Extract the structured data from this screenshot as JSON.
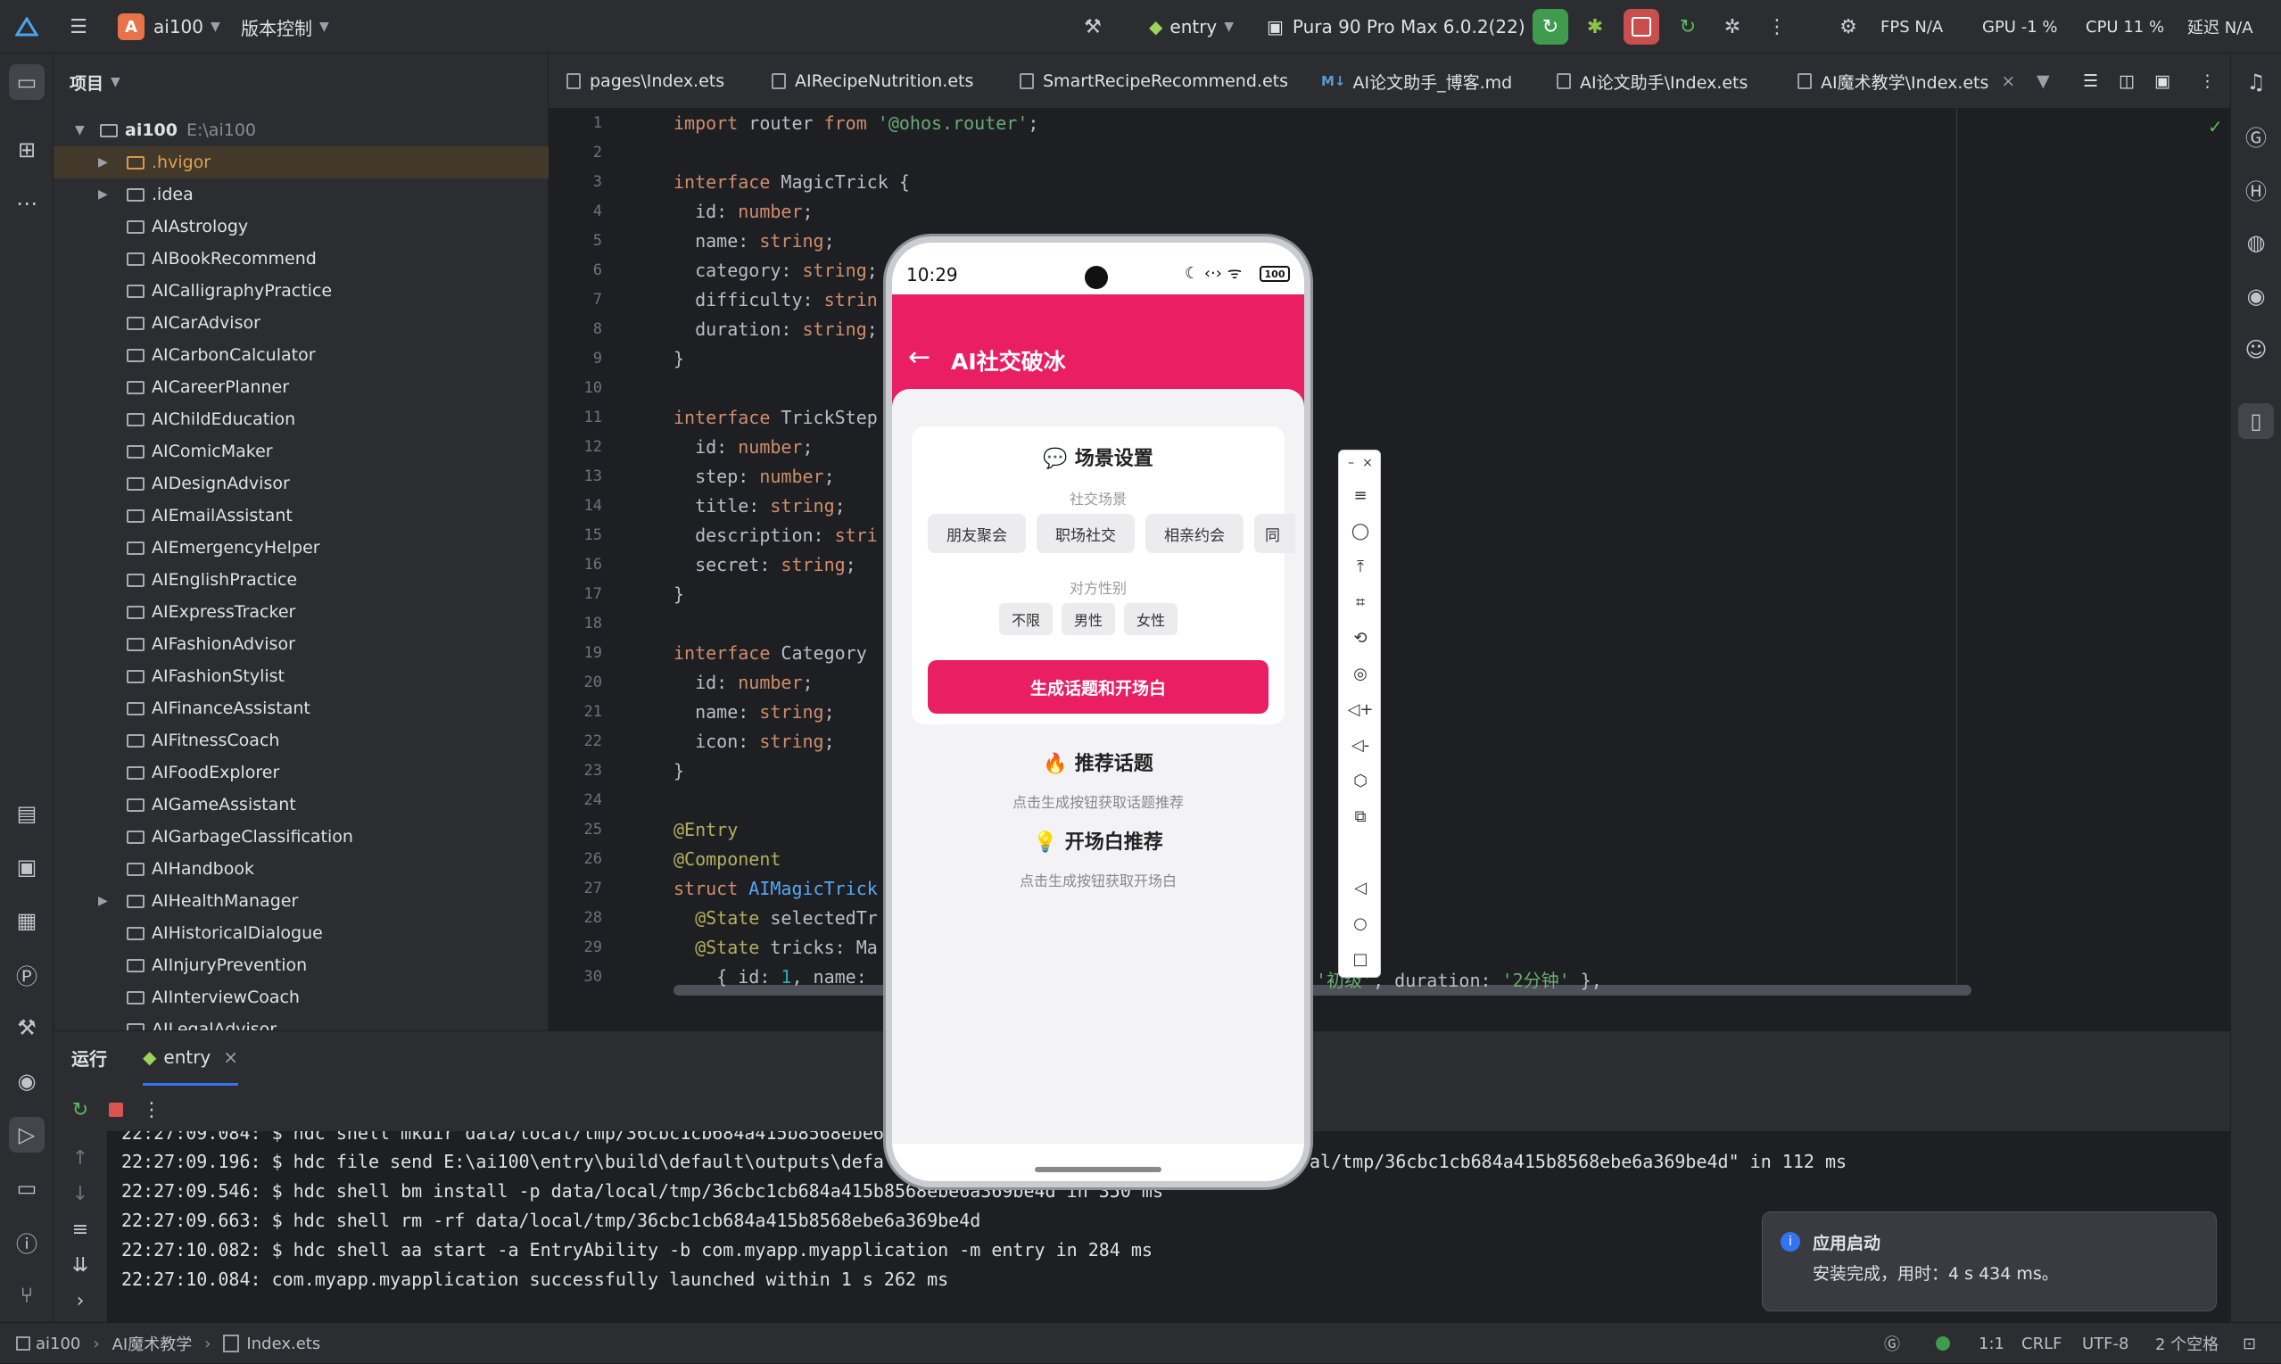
{
  "titlebar": {
    "project_badge": "A",
    "project_name": "ai100",
    "vcs_label": "版本控制",
    "run_config": "entry",
    "device": "Pura 90 Pro Max 6.0.2(22)",
    "fps": "FPS N/A",
    "gpu": "GPU -1 %",
    "cpu": "CPU 11 %",
    "latency": "延迟 N/A"
  },
  "project_panel": {
    "title": "项目",
    "root_name": "ai100",
    "root_path": "E:\\ai100",
    "items": [
      ".hvigor",
      ".idea",
      "AIAstrology",
      "AIBookRecommend",
      "AICalligraphyPractice",
      "AICarAdvisor",
      "AICarbonCalculator",
      "AICareerPlanner",
      "AIChildEducation",
      "AIComicMaker",
      "AIDesignAdvisor",
      "AIEmailAssistant",
      "AIEmergencyHelper",
      "AIEnglishPractice",
      "AIExpressTracker",
      "AIFashionAdvisor",
      "AIFashionStylist",
      "AIFinanceAssistant",
      "AIFitnessCoach",
      "AIFoodExplorer",
      "AIGameAssistant",
      "AIGarbageClassification",
      "AIHandbook",
      "AIHealthManager",
      "AIHistoricalDialogue",
      "AIInjuryPrevention",
      "AIInterviewCoach",
      "AILegalAdvisor"
    ]
  },
  "tabs": [
    "pages\\Index.ets",
    "AIRecipeNutrition.ets",
    "SmartRecipeRecommend.ets",
    "AI论文助手_博客.md",
    "AI论文助手\\Index.ets",
    "AI魔术教学\\Index.ets"
  ],
  "code": {
    "line_numbers": [
      "1",
      "2",
      "3",
      "4",
      "5",
      "6",
      "7",
      "8",
      "9",
      "10",
      "11",
      "12",
      "13",
      "14",
      "15",
      "16",
      "17",
      "18",
      "19",
      "20",
      "21",
      "22",
      "23",
      "24",
      "25",
      "26",
      "27",
      "28",
      "29",
      "30"
    ],
    "l1_kw": "import",
    "l1_mid": " router ",
    "l1_kw2": "from",
    "l1_str": "'@ohos.router'",
    "l1_end": ";",
    "l3_kw": "interface",
    "l3_name": " MagicTrick {",
    "l4a": "  id: ",
    "l4b": "number",
    "l4c": ";",
    "l5a": "  name: ",
    "l5b": "string",
    "l5c": ";",
    "l6a": "  category: ",
    "l6b": "string",
    "l6c": ";",
    "l7a": "  difficulty: ",
    "l7b": "strin",
    "l8a": "  duration: ",
    "l8b": "string",
    "l8c": ";",
    "l9": "}",
    "l11_kw": "interface",
    "l11_name": " TrickStep",
    "l12a": "  id: ",
    "l12b": "number",
    "l12c": ";",
    "l13a": "  step: ",
    "l13b": "number",
    "l13c": ";",
    "l14a": "  title: ",
    "l14b": "string",
    "l14c": ";",
    "l15a": "  description: ",
    "l15b": "stri",
    "l16a": "  secret: ",
    "l16b": "string",
    "l16c": ";",
    "l17": "}",
    "l19_kw": "interface",
    "l19_name": " Category",
    "l20a": "  id: ",
    "l20b": "number",
    "l20c": ";",
    "l21a": "  name: ",
    "l21b": "string",
    "l21c": ";",
    "l22a": "  icon: ",
    "l22b": "string",
    "l22c": ";",
    "l23": "}",
    "l25": "@Entry",
    "l26": "@Component",
    "l27_kw": "struct",
    "l27_name": " AIMagicTrick",
    "l28_dec": "  @State",
    "l28_rest": " selectedTr",
    "l29_dec": "  @State",
    "l29_rest": " tricks: Ma",
    "l30a": "    { id: ",
    "l30b": "1",
    "l30c": ", name:",
    "l30_tail_str": "'初级'",
    "l30_tail_mid": ", duration: ",
    "l30_tail_str2": "'2分钟'",
    "l30_tail_end": " },"
  },
  "run_panel": {
    "tab_run": "运行",
    "tab_entry": "entry",
    "lines": [
      "22:27:09.084: $ hdc shell mkdir data/local/tmp/36cbc1cb684a415b8568ebe6",
      "22:27:09.196: $ hdc file send E:\\ai100\\entry\\build\\default\\outputs\\defa",
      "22:27:09.546: $ hdc shell bm install -p data/local/tmp/36cbc1cb684a415b8568ebe6a369be4d in 350 ms",
      "22:27:09.663: $ hdc shell rm -rf data/local/tmp/36cbc1cb684a415b8568ebe6a369be4d",
      "22:27:10.082: $ hdc shell aa start -a EntryAbility -b com.myapp.myapplication -m entry in 284 ms",
      "22:27:10.084: com.myapp.myapplication successfully launched within 1 s 262 ms"
    ],
    "line2_tail": "al/tmp/36cbc1cb684a415b8568ebe6a369be4d\" in 112 ms"
  },
  "notification": {
    "title": "应用启动",
    "body": "安装完成，用时：4 s 434 ms。"
  },
  "statusbar": {
    "crumb1": "ai100",
    "crumb2": "AI魔术教学",
    "crumb3": "Index.ets",
    "position": "1:1",
    "line_sep": "CRLF",
    "encoding": "UTF-8",
    "indent": "2 个空格"
  },
  "phone": {
    "time": "10:29",
    "battery": "100",
    "app_title": "AI社交破冰",
    "scene_card_title": "场景设置",
    "scene_label": "社交场景",
    "scenes": [
      "朋友聚会",
      "职场社交",
      "相亲约会",
      "同"
    ],
    "gender_label": "对方性别",
    "genders": [
      "不限",
      "男性",
      "女性"
    ],
    "generate_button": "生成话题和开场白",
    "topics_title": "推荐话题",
    "topics_hint": "点击生成按钮获取话题推荐",
    "openers_title": "开场白推荐",
    "openers_hint": "点击生成按钮获取开场白"
  },
  "colors": {
    "accent": "#e91e63",
    "ide_bg": "#1e1f22",
    "ide_panel": "#2b2d30",
    "run_green": "#3f9c4f"
  }
}
